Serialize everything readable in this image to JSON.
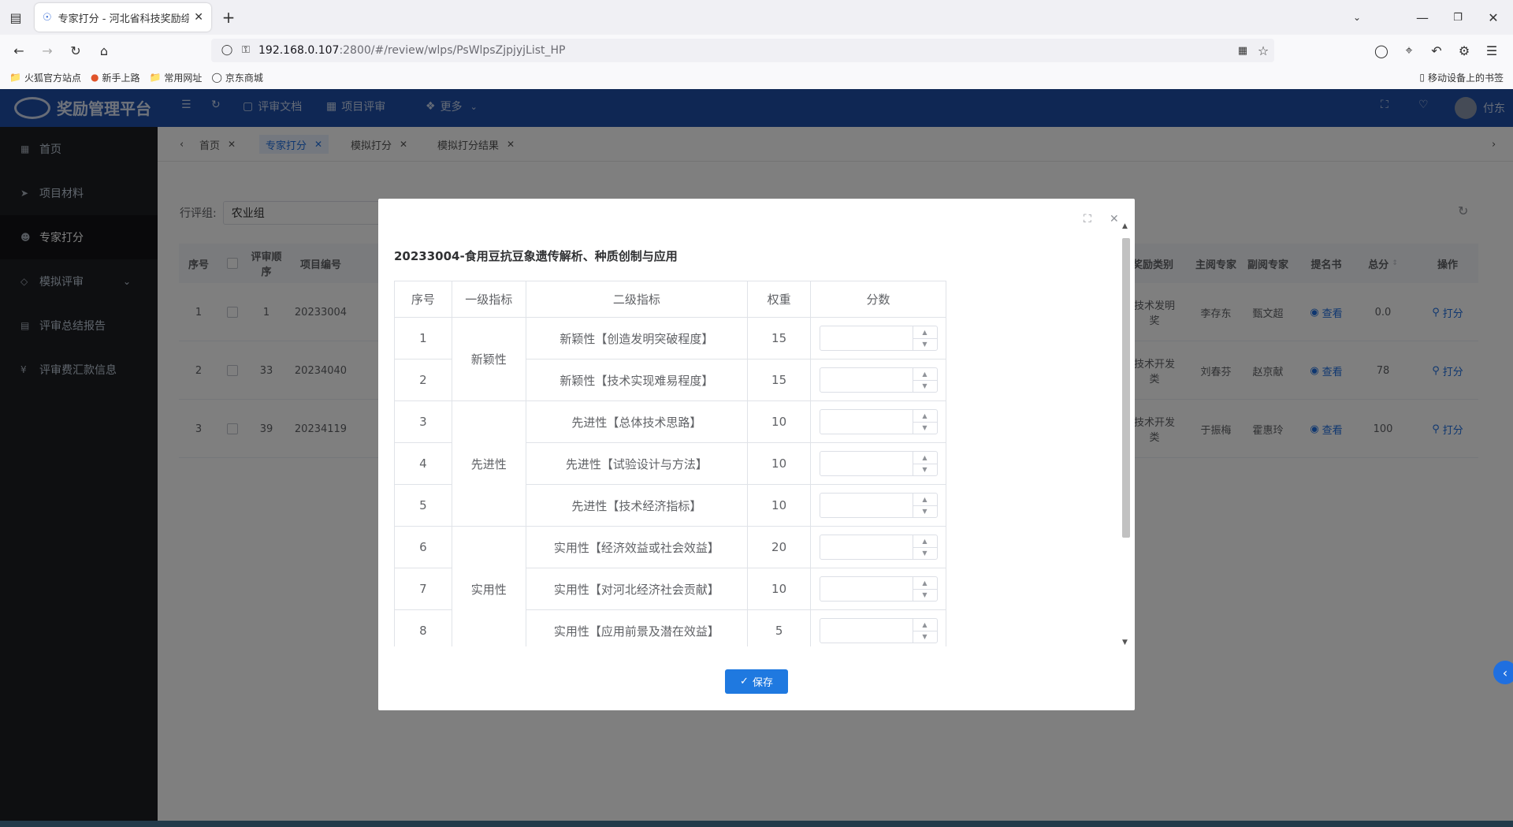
{
  "browser": {
    "tab_title": "专家打分 - 河北省科技奖励综合",
    "url_host": "192.168.0.107",
    "url_rest": ":2800/#/review/wlps/PsWlpsZjpjyjList_HP",
    "bookmarks": [
      "火狐官方站点",
      "新手上路",
      "常用网址",
      "京东商城"
    ],
    "mobile_bookmarks": "移动设备上的书签"
  },
  "app": {
    "logo_text": "奖励管理平台",
    "header_nav": [
      "评审文档",
      "项目评审",
      "更多"
    ],
    "user": "付东"
  },
  "sidebar": {
    "items": [
      {
        "label": "首页",
        "icon": "grid-icon"
      },
      {
        "label": "项目材料",
        "icon": "send-icon"
      },
      {
        "label": "专家打分",
        "icon": "user-icon",
        "active": true
      },
      {
        "label": "模拟评审",
        "icon": "tag-icon",
        "has_children": true
      },
      {
        "label": "评审总结报告",
        "icon": "doc-icon"
      },
      {
        "label": "评审费汇款信息",
        "icon": "yen-icon"
      }
    ]
  },
  "tags": [
    {
      "label": "首页"
    },
    {
      "label": "专家打分",
      "active": true
    },
    {
      "label": "模拟打分"
    },
    {
      "label": "模拟打分结果"
    }
  ],
  "filter": {
    "label": "行评组:",
    "value": "农业组"
  },
  "grid": {
    "headers": {
      "seq": "序号",
      "order": "评审顺序",
      "code": "项目编号",
      "award_type": "奖励类别",
      "main_expert": "主阅专家",
      "sub_expert": "副阅专家",
      "nomination": "提名书",
      "total": "总分",
      "action": "操作"
    },
    "rows": [
      {
        "seq": "1",
        "order": "1",
        "code": "20233004",
        "award_type": "技术发明奖",
        "main_expert": "李存东",
        "sub_expert": "甄文超",
        "view": "查看",
        "total": "0.0",
        "action": "打分"
      },
      {
        "seq": "2",
        "order": "33",
        "code": "20234040",
        "award_type": "技术开发类",
        "main_expert": "刘春芬",
        "sub_expert": "赵京献",
        "view": "查看",
        "total": "78",
        "action": "打分"
      },
      {
        "seq": "3",
        "order": "39",
        "code": "20234119",
        "award_type": "技术开发类",
        "main_expert": "于振梅",
        "sub_expert": "霍惠玲",
        "view": "查看",
        "total": "100",
        "action": "打分"
      }
    ]
  },
  "modal": {
    "title": "20233004-食用豆抗豆象遗传解析、种质创制与应用",
    "table_headers": [
      "序号",
      "一级指标",
      "二级指标",
      "权重",
      "分数"
    ],
    "rows": [
      {
        "seq": "1",
        "level1": "新颖性",
        "level2": "新颖性【创造发明突破程度】",
        "weight": "15"
      },
      {
        "seq": "2",
        "level1": "",
        "level2": "新颖性【技术实现难易程度】",
        "weight": "15"
      },
      {
        "seq": "3",
        "level1": "先进性",
        "level2": "先进性【总体技术思路】",
        "weight": "10"
      },
      {
        "seq": "4",
        "level1": "",
        "level2": "先进性【试验设计与方法】",
        "weight": "10"
      },
      {
        "seq": "5",
        "level1": "",
        "level2": "先进性【技术经济指标】",
        "weight": "10"
      },
      {
        "seq": "6",
        "level1": "实用性",
        "level2": "实用性【经济效益或社会效益】",
        "weight": "20"
      },
      {
        "seq": "7",
        "level1": "",
        "level2": "实用性【对河北经济社会贡献】",
        "weight": "10"
      },
      {
        "seq": "8",
        "level1": "",
        "level2": "实用性【应用前景及潜在效益】",
        "weight": "5"
      }
    ],
    "save_label": "保存"
  }
}
